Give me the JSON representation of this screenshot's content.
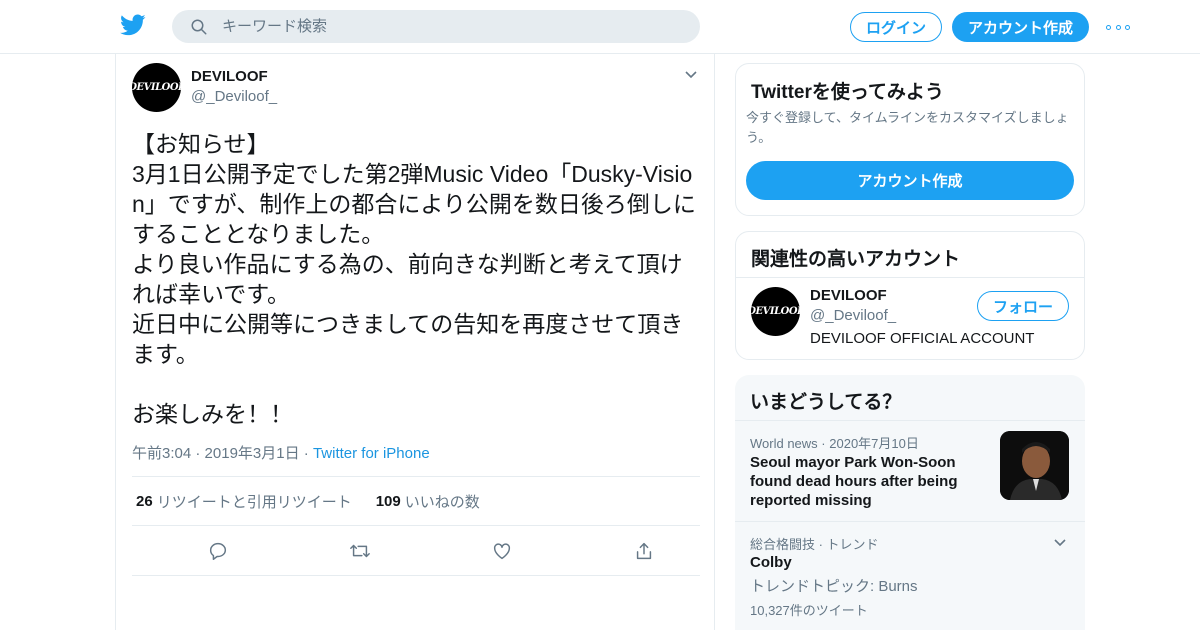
{
  "header": {
    "search_placeholder": "キーワード検索",
    "login_label": "ログイン",
    "signup_label": "アカウント作成"
  },
  "tweet": {
    "author_name": "DEVILOOF",
    "author_handle": "@_Deviloof_",
    "avatar_text": "DEVILOOF",
    "text": "【お知らせ】\n3月1日公開予定でした第2弾Music Video「Dusky-Vision」ですが、制作上の都合により公開を数日後ろ倒しにすることとなりました。\nより良い作品にする為の、前向きな判断と考えて頂ければ幸いです。\n近日中に公開等につきましての告知を再度させて頂きます。\n\nお楽しみを！！",
    "time": "午前3:04",
    "date": "2019年3月1日",
    "source": "Twitter for iPhone",
    "retweet_count": "26",
    "retweet_label": "リツイートと引用リツイート",
    "like_count": "109",
    "like_label": "いいねの数"
  },
  "signup_card": {
    "title": "Twitterを使ってみよう",
    "description": "今すぐ登録して、タイムラインをカスタマイズしましょう。",
    "button_label": "アカウント作成"
  },
  "related_card": {
    "title": "関連性の高いアカウント",
    "account_name": "DEVILOOF",
    "account_handle": "@_Deviloof_",
    "account_bio": "DEVILOOF OFFICIAL ACCOUNT",
    "follow_label": "フォロー"
  },
  "trends_card": {
    "title": "いまどうしてる？",
    "news": {
      "category": "World news",
      "date": "2020年7月10日",
      "headline": "Seoul mayor Park Won-Soon found dead hours after being reported missing"
    },
    "trend": {
      "context": "総合格闘技 · トレンド",
      "name": "Colby",
      "topic": "トレンドトピック: Burns",
      "count": "10,327件のツイート"
    }
  },
  "colors": {
    "accent": "#1da1f2",
    "text_primary": "#14171a",
    "text_secondary": "#657786",
    "border": "#e6ecf0",
    "trend_bg": "#f5f8fa"
  },
  "icons": [
    "twitter-bird-icon",
    "search-icon",
    "more-icon",
    "caret-down-icon",
    "reply-icon",
    "retweet-icon",
    "like-icon",
    "share-icon"
  ]
}
